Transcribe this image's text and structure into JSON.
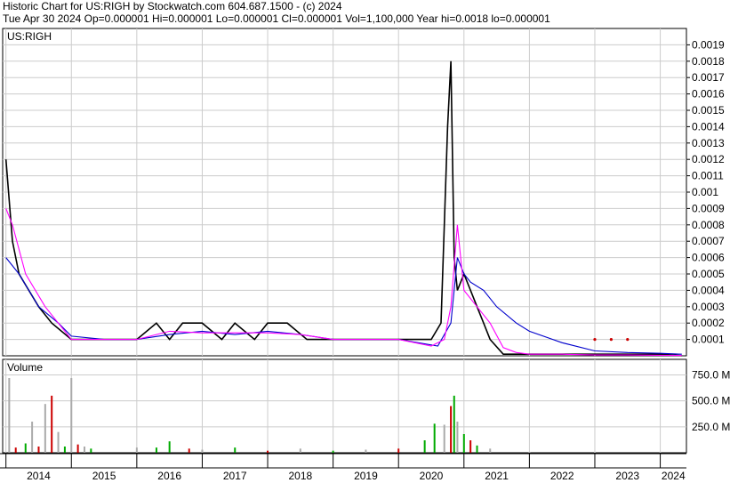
{
  "header": {
    "line1": "Historic Chart for US:RIGH by Stockwatch.com 604.687.1500 - (c) 2024",
    "line2": "Tue Apr 30 2024   Op=0.000001   Hi=0.000001   Lo=0.000001   Cl=0.000001   Vol=1,100,000   Year hi=0.0018   lo=0.000001"
  },
  "chart_data": [
    {
      "type": "line",
      "title": "US:RIGH",
      "ylim": [
        0,
        0.002
      ],
      "y_ticks": [
        "0.0001",
        "0.0002",
        "0.0003",
        "0.0004",
        "0.0005",
        "0.0006",
        "0.0007",
        "0.0008",
        "0.0009",
        "0.001",
        "0.0011",
        "0.0012",
        "0.0013",
        "0.0014",
        "0.0015",
        "0.0016",
        "0.0017",
        "0.0018",
        "0.0019"
      ],
      "x_ticks": [
        "2014",
        "2015",
        "2016",
        "2017",
        "2018",
        "2019",
        "2020",
        "2021",
        "2022",
        "2023",
        "2024"
      ],
      "grid": true,
      "series": [
        {
          "color": "#000000",
          "x": [
            2014.0,
            2014.1,
            2014.2,
            2014.35,
            2014.5,
            2014.7,
            2015.0,
            2015.5,
            2016.0,
            2016.3,
            2016.5,
            2016.7,
            2017.0,
            2017.3,
            2017.5,
            2017.8,
            2018.0,
            2018.3,
            2018.6,
            2019.0,
            2019.5,
            2020.0,
            2020.5,
            2020.65,
            2020.75,
            2020.8,
            2020.85,
            2020.9,
            2021.0,
            2021.1,
            2021.2,
            2021.3,
            2021.4,
            2021.6,
            2022.0,
            2022.5,
            2023.0,
            2023.5,
            2024.0,
            2024.33
          ],
          "values": [
            0.0012,
            0.0007,
            0.0005,
            0.0004,
            0.0003,
            0.0002,
            0.0001,
            0.0001,
            0.0001,
            0.0002,
            0.0001,
            0.0002,
            0.0002,
            0.0001,
            0.0002,
            0.0001,
            0.0002,
            0.0002,
            0.0001,
            0.0001,
            0.0001,
            0.0001,
            0.0001,
            0.0002,
            0.0014,
            0.0018,
            0.0006,
            0.0004,
            0.0005,
            0.0004,
            0.0003,
            0.0002,
            0.0001,
            1e-05,
            1e-05,
            1e-05,
            1e-05,
            1e-05,
            1e-05,
            1e-06
          ]
        },
        {
          "color": "#0000cc",
          "x": [
            2014.0,
            2014.2,
            2014.5,
            2014.8,
            2015.0,
            2015.5,
            2016.0,
            2016.5,
            2017.0,
            2017.5,
            2018.0,
            2018.5,
            2019.0,
            2019.5,
            2020.0,
            2020.3,
            2020.6,
            2020.8,
            2020.9,
            2021.0,
            2021.1,
            2021.3,
            2021.5,
            2021.8,
            2022.0,
            2022.5,
            2023.0,
            2023.5,
            2024.0,
            2024.33
          ],
          "values": [
            0.0006,
            0.0005,
            0.0003,
            0.0002,
            0.00012,
            0.0001,
            0.0001,
            0.00013,
            0.00015,
            0.00013,
            0.00015,
            0.00013,
            0.0001,
            0.0001,
            0.0001,
            8e-05,
            6e-05,
            0.0002,
            0.0006,
            0.0005,
            0.00045,
            0.0004,
            0.0003,
            0.0002,
            0.00015,
            8e-05,
            3e-05,
            2e-05,
            1.5e-05,
            1e-05
          ]
        },
        {
          "color": "#ff00ff",
          "x": [
            2014.0,
            2014.1,
            2014.3,
            2014.6,
            2015.0,
            2015.5,
            2016.0,
            2016.5,
            2017.0,
            2017.5,
            2018.0,
            2018.5,
            2019.0,
            2019.5,
            2020.0,
            2020.5,
            2020.7,
            2020.8,
            2020.9,
            2021.0,
            2021.2,
            2021.4,
            2021.6,
            2021.8,
            2022.0,
            2022.5,
            2023.0,
            2023.5,
            2024.0,
            2024.33
          ],
          "values": [
            0.0009,
            0.0008,
            0.0005,
            0.0003,
            0.0001,
            0.0001,
            0.0001,
            0.00015,
            0.00014,
            0.00014,
            0.00014,
            0.00013,
            0.0001,
            0.0001,
            0.0001,
            6e-05,
            0.0001,
            0.0003,
            0.0008,
            0.0004,
            0.0003,
            0.0002,
            5e-05,
            2e-05,
            1e-05,
            1e-05,
            5e-06,
            5e-06,
            3e-06,
            2e-06
          ]
        }
      ],
      "markers": [
        {
          "color": "#cc0000",
          "x": [
            2023.0,
            2023.25,
            2023.5
          ],
          "values": [
            0.0001,
            0.0001,
            0.0001
          ]
        }
      ]
    },
    {
      "type": "bar",
      "title": "Volume",
      "ylim": [
        0,
        900000000
      ],
      "y_ticks": [
        "250.0 M",
        "500.0 M",
        "750.0 M"
      ],
      "x_ticks": [
        "2014",
        "2015",
        "2016",
        "2017",
        "2018",
        "2019",
        "2020",
        "2021",
        "2022",
        "2023",
        "2024"
      ],
      "x": [
        2014.05,
        2014.15,
        2014.3,
        2014.4,
        2014.5,
        2014.6,
        2014.7,
        2014.8,
        2014.9,
        2015.0,
        2015.1,
        2015.2,
        2015.3,
        2016.0,
        2016.3,
        2016.5,
        2016.8,
        2017.0,
        2017.5,
        2018.0,
        2018.5,
        2019.0,
        2019.5,
        2020.0,
        2020.4,
        2020.55,
        2020.7,
        2020.8,
        2020.85,
        2020.9,
        2021.0,
        2021.1,
        2021.2,
        2021.4,
        2022.0,
        2023.0,
        2024.0
      ],
      "values": [
        720000000,
        50000000,
        90000000,
        300000000,
        60000000,
        470000000,
        550000000,
        200000000,
        60000000,
        720000000,
        80000000,
        60000000,
        40000000,
        50000000,
        50000000,
        110000000,
        40000000,
        30000000,
        50000000,
        20000000,
        40000000,
        20000000,
        30000000,
        40000000,
        120000000,
        280000000,
        270000000,
        450000000,
        550000000,
        300000000,
        180000000,
        120000000,
        70000000,
        40000000,
        5000000,
        3000000,
        2000000
      ],
      "colors": [
        "#aaaaaa",
        "#cc0000",
        "#00aa00",
        "#aaaaaa",
        "#cc0000",
        "#aaaaaa",
        "#cc0000",
        "#aaaaaa",
        "#00aa00",
        "#aaaaaa",
        "#cc0000",
        "#aaaaaa",
        "#00aa00",
        "#aaaaaa",
        "#00aa00",
        "#00aa00",
        "#cc0000",
        "#aaaaaa",
        "#00aa00",
        "#cc0000",
        "#aaaaaa",
        "#00aa00",
        "#aaaaaa",
        "#cc0000",
        "#00aa00",
        "#00aa00",
        "#aaaaaa",
        "#cc0000",
        "#00aa00",
        "#aaaaaa",
        "#00aa00",
        "#cc0000",
        "#00aa00",
        "#aaaaaa",
        "#aaaaaa",
        "#aaaaaa",
        "#aaaaaa"
      ]
    }
  ]
}
